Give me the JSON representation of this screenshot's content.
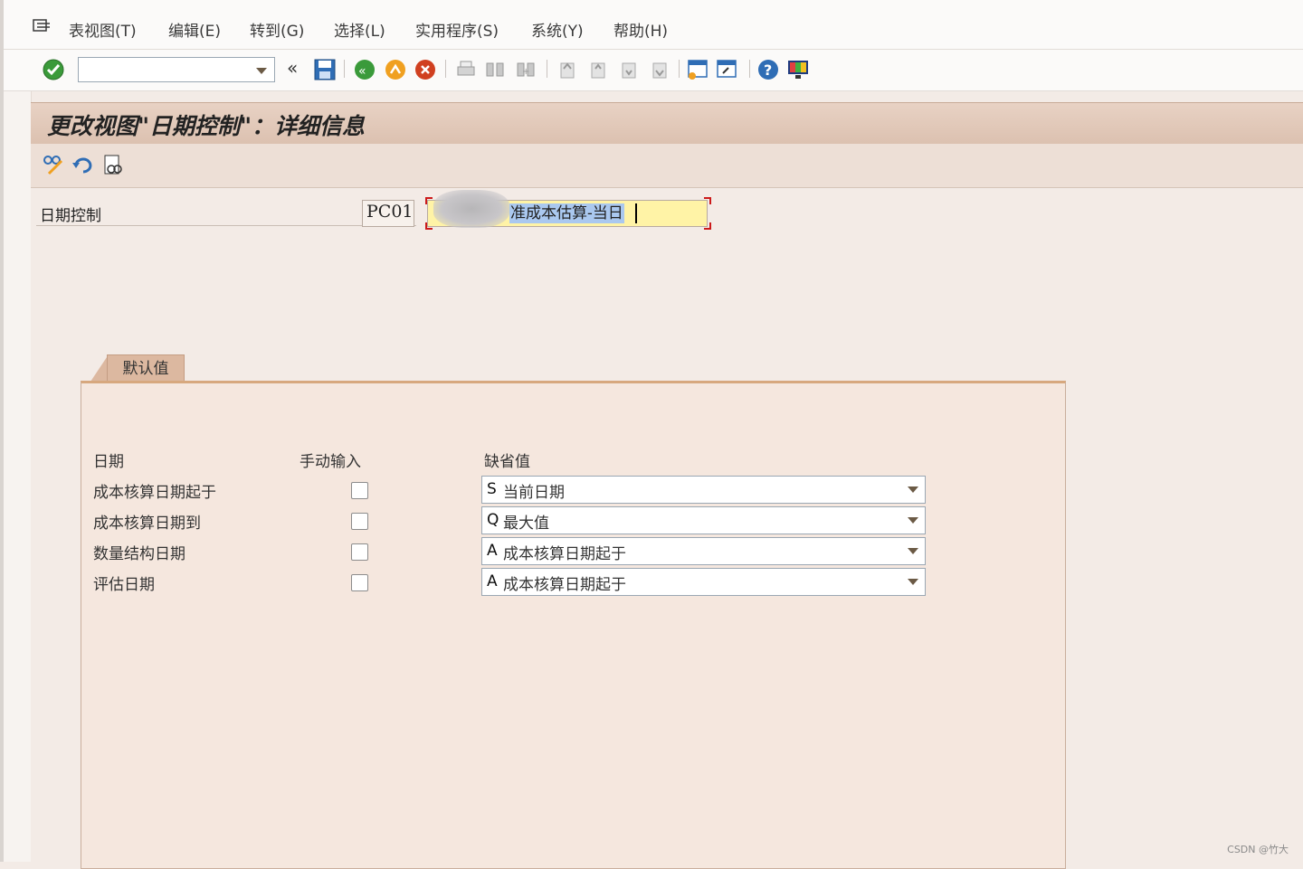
{
  "menu": {
    "items": [
      "表视图(T)",
      "编辑(E)",
      "转到(G)",
      "选择(L)",
      "实用程序(S)",
      "系统(Y)",
      "帮助(H)"
    ]
  },
  "toolbar": {
    "command_value": "",
    "back_glyph": "«",
    "icons": [
      "enter-icon",
      "command-dropdown-icon",
      "save-icon",
      "back-icon",
      "exit-icon",
      "cancel-icon",
      "print-icon",
      "find-icon",
      "find-next-icon",
      "first-page-icon",
      "previous-page-icon",
      "next-page-icon",
      "last-page-icon",
      "create-session-icon",
      "shortcut-icon",
      "help-icon",
      "customize-layout-icon"
    ]
  },
  "title": "更改视图\"日期控制\"：详细信息",
  "app_toolbar": {
    "icons": [
      "display-change-icon",
      "undo-icon",
      "other-entry-icon"
    ]
  },
  "header_field": {
    "label": "日期控制",
    "key": "PC01",
    "description": "准成本估算-当日"
  },
  "tab": {
    "label": "默认值"
  },
  "table": {
    "headers": [
      "日期",
      "手动输入",
      "缺省值"
    ],
    "rows": [
      {
        "label": "成本核算日期起于",
        "checked": false,
        "key": "S",
        "value": "当前日期"
      },
      {
        "label": "成本核算日期到",
        "checked": false,
        "key": "Q",
        "value": "最大值"
      },
      {
        "label": "数量结构日期",
        "checked": false,
        "key": "A",
        "value": "成本核算日期起于"
      },
      {
        "label": "评估日期",
        "checked": false,
        "key": "A",
        "value": "成本核算日期起于"
      }
    ]
  },
  "watermark": "CSDN @竹大",
  "colors": {
    "title_bar": "#dcc1b0",
    "tab": "#dcb8a0",
    "panel": "#f5e7de",
    "focus_field": "#fff3a6",
    "selection": "#aac8ef",
    "error_corner": "#cc1a1a"
  }
}
